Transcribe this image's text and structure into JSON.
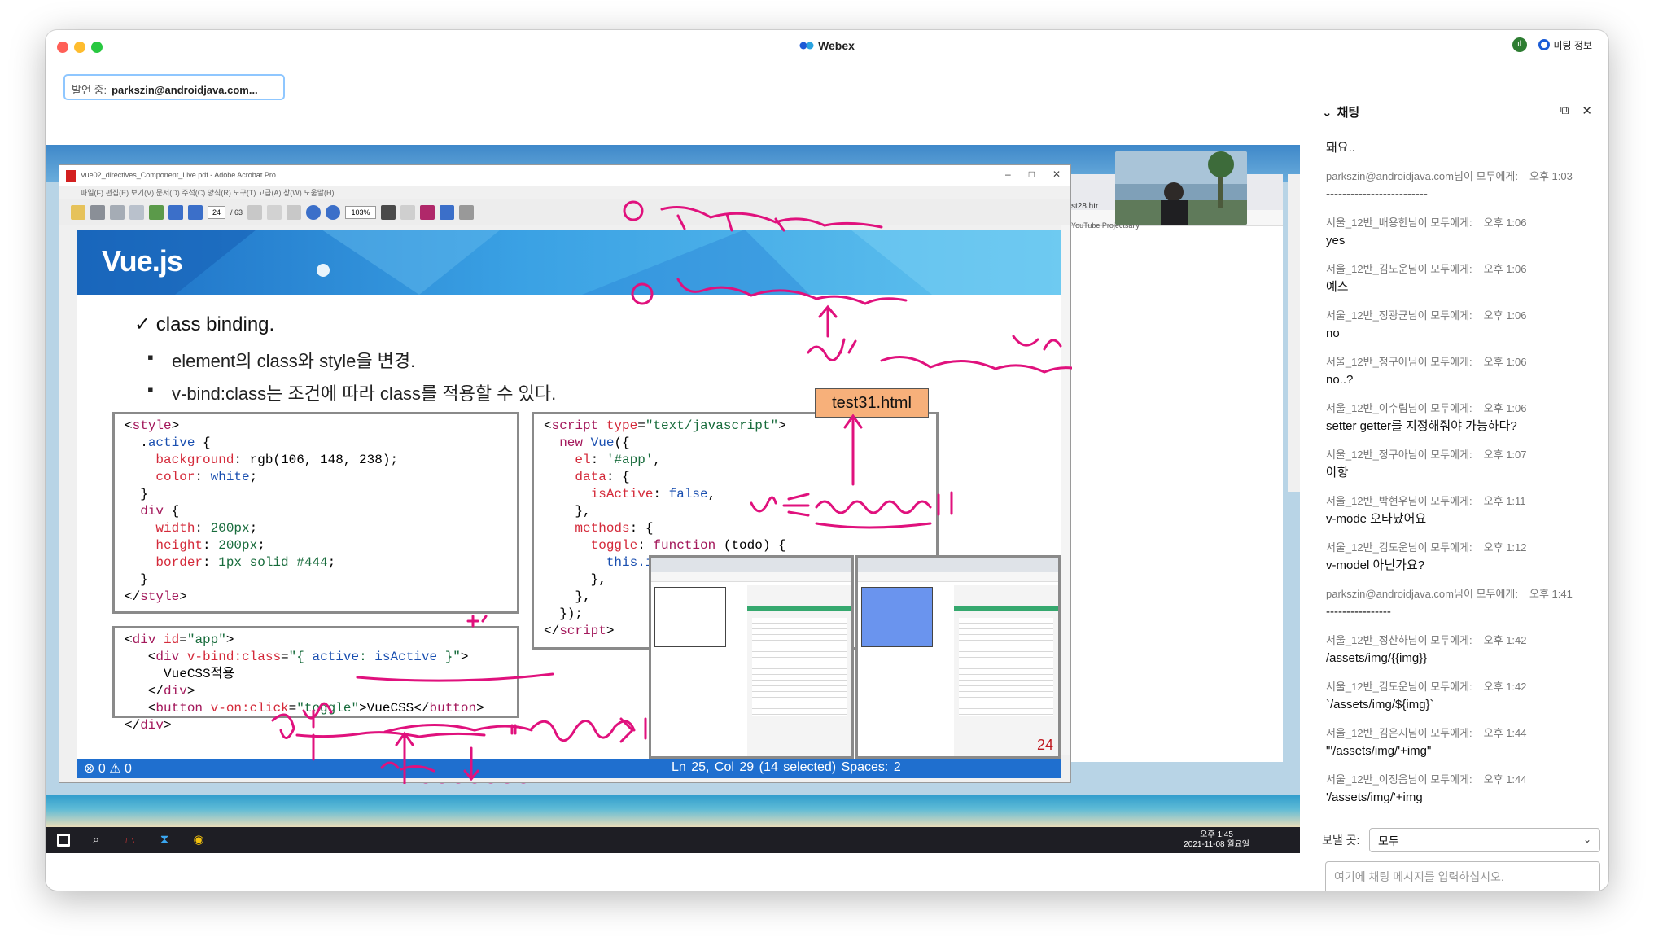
{
  "window": {
    "title": "Webex",
    "meeting_info": "미팅 정보"
  },
  "presenter": {
    "label": "발언 중:",
    "value": "parkszin@androidjava.com..."
  },
  "acrobat": {
    "title": "Vue02_directives_Component_Live.pdf - Adobe Acrobat Pro",
    "menu": "파일(F)  편집(E)  보기(V)  문서(D)  주석(C)  양식(R)  도구(T)  고급(A)  창(W)  도움말(H)",
    "page_current": "24",
    "page_total": "/ 63",
    "zoom": "103%"
  },
  "browser_behind": {
    "tab_text": "st28.htr",
    "bookmarks": "YouTube    Projectsally"
  },
  "slide": {
    "title": "Vue.js",
    "bullet_main": "✓ class binding.",
    "bullet_sub_1": "element의 class와 style을 변경.",
    "bullet_sub_2": "v-bind:class는 조건에 따라 class를 적용할 수 있다.",
    "file_badge": "test31.html",
    "page_number": "24"
  },
  "status_bar": {
    "left": "⊗ 0 ⚠ 0",
    "right": "Ln 25, Col 29 (14 selected)   Spaces: 2"
  },
  "taskbar": {
    "time": "오후 1:45",
    "date": "2021-11-08 월요일"
  },
  "chat": {
    "title": "채팅",
    "messages": [
      {
        "sender": "",
        "time": "",
        "text": "돼요.."
      },
      {
        "sender": "parkszin@androidjava.com님이 모두에게:",
        "time": "오후 1:03",
        "text": "-------------------------"
      },
      {
        "sender": "서울_12반_배용한님이 모두에게:",
        "time": "오후 1:06",
        "text": "yes"
      },
      {
        "sender": "서울_12반_김도운님이 모두에게:",
        "time": "오후 1:06",
        "text": "예스"
      },
      {
        "sender": "서울_12반_정광균님이 모두에게:",
        "time": "오후 1:06",
        "text": "no"
      },
      {
        "sender": "서울_12반_정구아님이 모두에게:",
        "time": "오후 1:06",
        "text": "no..?"
      },
      {
        "sender": "서울_12반_이수림님이 모두에게:",
        "time": "오후 1:06",
        "text": "setter getter를 지정해줘야 가능하다?"
      },
      {
        "sender": "서울_12반_정구아님이 모두에게:",
        "time": "오후 1:07",
        "text": "아항"
      },
      {
        "sender": "서울_12반_박현우님이 모두에게:",
        "time": "오후 1:11",
        "text": "v-mode 오타났어요"
      },
      {
        "sender": "서울_12반_김도운님이 모두에게:",
        "time": "오후 1:12",
        "text": "v-model 아닌가요?"
      },
      {
        "sender": "parkszin@androidjava.com님이 모두에게:",
        "time": "오후 1:41",
        "text": "----------------"
      },
      {
        "sender": "서울_12반_정산하님이 모두에게:",
        "time": "오후 1:42",
        "text": "/assets/img/{{img}}"
      },
      {
        "sender": "서울_12반_김도운님이 모두에게:",
        "time": "오후 1:42",
        "text": "`/assets/img/${img}`"
      },
      {
        "sender": "서울_12반_김은지님이 모두에게:",
        "time": "오후 1:44",
        "text": "\"'/assets/img/'+img\""
      },
      {
        "sender": "서울_12반_이정음님이 모두에게:",
        "time": "오후 1:44",
        "text": "'/assets/img/'+img"
      }
    ],
    "send_label": "보낼 곳:",
    "send_target": "모두",
    "input_placeholder": "여기에 채팅 메시지를 입력하십시오."
  },
  "colors": {
    "accent": "#1b5cd6",
    "annotation": "#e0117d",
    "status_bar": "#1f6fcf"
  }
}
